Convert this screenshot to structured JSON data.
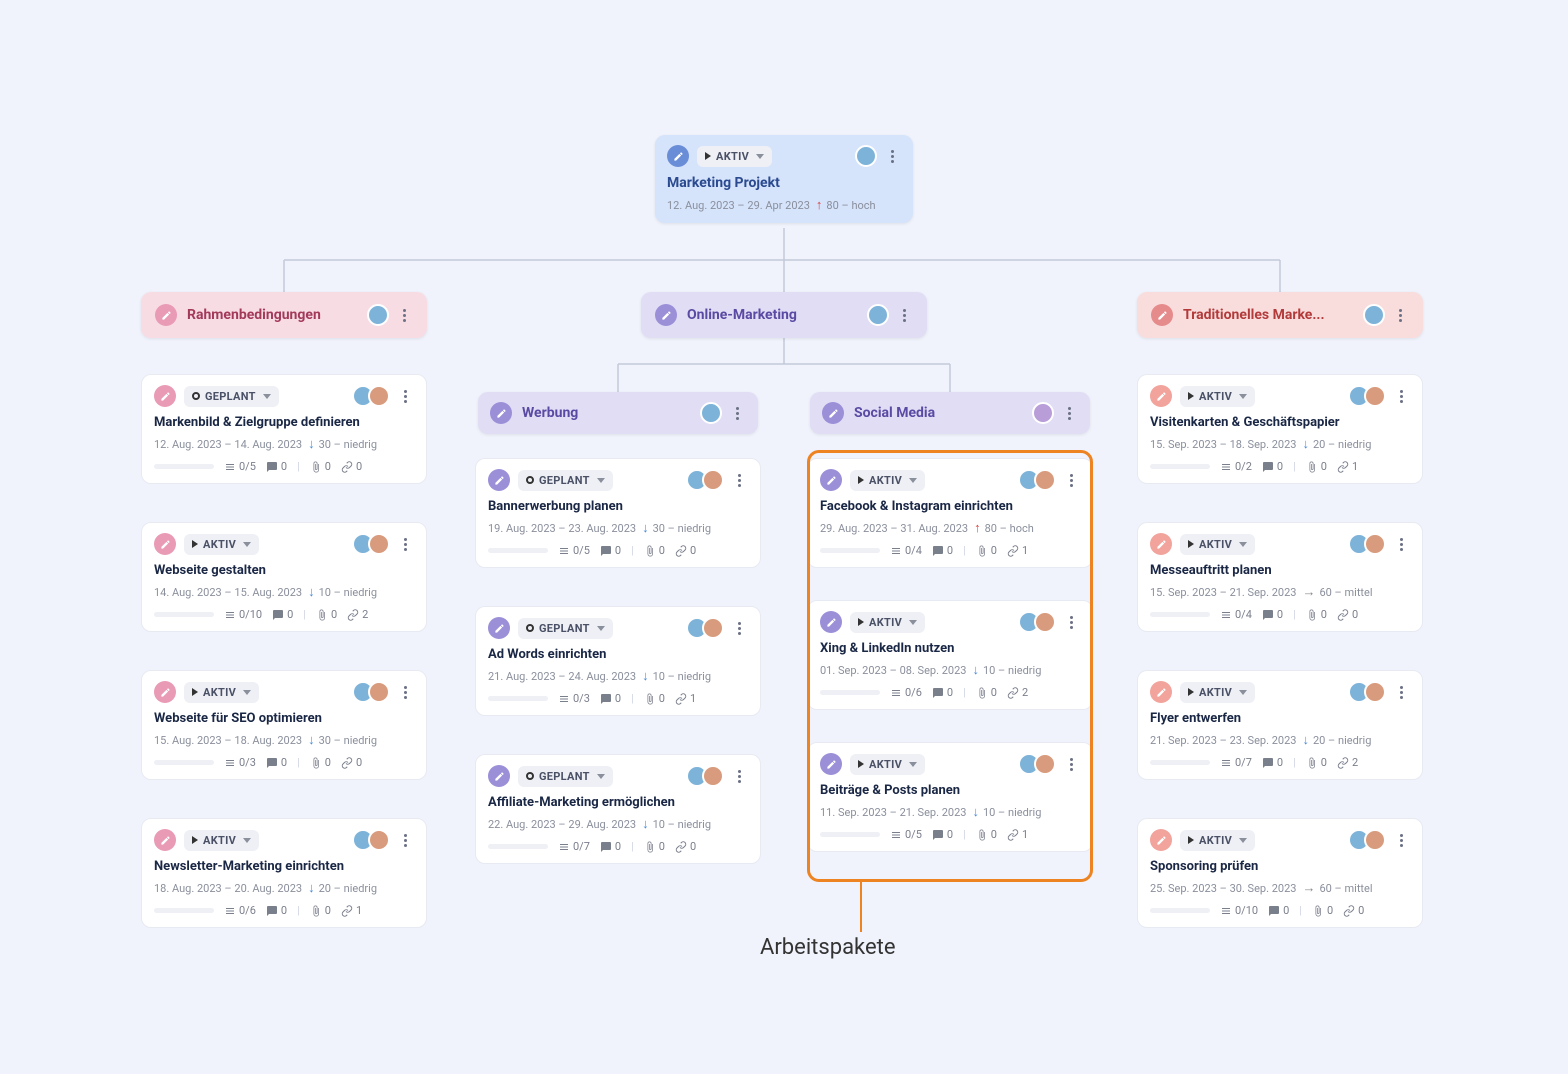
{
  "root": {
    "status": "AKTIV",
    "title": "Marketing Projekt",
    "dates": "12. Aug. 2023 – 29. Apr 2023",
    "prio_arrow": "up",
    "prio": "80 – hoch"
  },
  "categories": [
    {
      "title": "Rahmenbedingungen",
      "color": "pink"
    },
    {
      "title": "Online-Marketing",
      "color": "purple"
    },
    {
      "title": "Traditionelles Marke...",
      "color": "red"
    }
  ],
  "subcategories": [
    {
      "title": "Werbung"
    },
    {
      "title": "Social Media"
    }
  ],
  "cards": {
    "col1": [
      {
        "edit": "pink",
        "statusType": "planned",
        "status": "GEPLANT",
        "title": "Markenbild & Zielgruppe definieren",
        "dates": "12. Aug. 2023 – 14. Aug. 2023",
        "arrow": "down",
        "prio": "30 – niedrig",
        "progress": "0/5",
        "comments": "0",
        "attachments": "0",
        "links": "0"
      },
      {
        "edit": "pink",
        "statusType": "active",
        "status": "AKTIV",
        "title": "Webseite gestalten",
        "dates": "14. Aug. 2023 – 15. Aug. 2023",
        "arrow": "down",
        "prio": "10 – niedrig",
        "progress": "0/10",
        "comments": "0",
        "attachments": "0",
        "links": "2"
      },
      {
        "edit": "pink",
        "statusType": "active",
        "status": "AKTIV",
        "title": "Webseite für SEO optimieren",
        "dates": "15. Aug. 2023 – 18. Aug. 2023",
        "arrow": "down",
        "prio": "30 – niedrig",
        "progress": "0/3",
        "comments": "0",
        "attachments": "0",
        "links": "0"
      },
      {
        "edit": "pink",
        "statusType": "active",
        "status": "AKTIV",
        "title": "Newsletter-Marketing einrichten",
        "dates": "18. Aug. 2023 – 20. Aug. 2023",
        "arrow": "down",
        "prio": "20 – niedrig",
        "progress": "0/6",
        "comments": "0",
        "attachments": "0",
        "links": "1"
      }
    ],
    "col2": [
      {
        "edit": "purple",
        "statusType": "planned",
        "status": "GEPLANT",
        "title": "Bannerwerbung planen",
        "dates": "19. Aug. 2023 – 23. Aug. 2023",
        "arrow": "down",
        "prio": "30 – niedrig",
        "progress": "0/5",
        "comments": "0",
        "attachments": "0",
        "links": "0"
      },
      {
        "edit": "purple",
        "statusType": "planned",
        "status": "GEPLANT",
        "title": "Ad Words einrichten",
        "dates": "21. Aug. 2023 – 24. Aug. 2023",
        "arrow": "down",
        "prio": "10 – niedrig",
        "progress": "0/3",
        "comments": "0",
        "attachments": "0",
        "links": "1"
      },
      {
        "edit": "purple",
        "statusType": "planned",
        "status": "GEPLANT",
        "title": "Affiliate-Marketing ermöglichen",
        "dates": "22. Aug. 2023 – 29. Aug. 2023",
        "arrow": "down",
        "prio": "10 – niedrig",
        "progress": "0/7",
        "comments": "0",
        "attachments": "0",
        "links": "0"
      }
    ],
    "col3": [
      {
        "edit": "purple",
        "statusType": "active",
        "status": "AKTIV",
        "title": "Facebook & Instagram einrichten",
        "dates": "29. Aug. 2023 – 31. Aug. 2023",
        "arrow": "up",
        "prio": "80 – hoch",
        "progress": "0/4",
        "comments": "0",
        "attachments": "0",
        "links": "1"
      },
      {
        "edit": "purple",
        "statusType": "active",
        "status": "AKTIV",
        "title": "Xing & LinkedIn nutzen",
        "dates": "01. Sep. 2023 – 08. Sep. 2023",
        "arrow": "down",
        "prio": "10 – niedrig",
        "progress": "0/6",
        "comments": "0",
        "attachments": "0",
        "links": "2"
      },
      {
        "edit": "purple",
        "statusType": "active",
        "status": "AKTIV",
        "title": "Beiträge & Posts planen",
        "dates": "11. Sep. 2023 – 21. Sep. 2023",
        "arrow": "down",
        "prio": "10 – niedrig",
        "progress": "0/5",
        "comments": "0",
        "attachments": "0",
        "links": "1"
      }
    ],
    "col4": [
      {
        "edit": "salmon",
        "statusType": "active",
        "status": "AKTIV",
        "title": "Visitenkarten & Geschäftspapier",
        "dates": "15. Sep. 2023 – 18. Sep. 2023",
        "arrow": "down",
        "prio": "20 – niedrig",
        "progress": "0/2",
        "comments": "0",
        "attachments": "0",
        "links": "1"
      },
      {
        "edit": "salmon",
        "statusType": "active",
        "status": "AKTIV",
        "title": "Messeauftritt planen",
        "dates": "15. Sep. 2023 – 21. Sep. 2023",
        "arrow": "right",
        "prio": "60 – mittel",
        "progress": "0/4",
        "comments": "0",
        "attachments": "0",
        "links": "0"
      },
      {
        "edit": "salmon",
        "statusType": "active",
        "status": "AKTIV",
        "title": "Flyer entwerfen",
        "dates": "21. Sep. 2023 – 23. Sep. 2023",
        "arrow": "down",
        "prio": "20 – niedrig",
        "progress": "0/7",
        "comments": "0",
        "attachments": "0",
        "links": "2"
      },
      {
        "edit": "salmon",
        "statusType": "active",
        "status": "AKTIV",
        "title": "Sponsoring prüfen",
        "dates": "25. Sep. 2023 – 30. Sep. 2023",
        "arrow": "right",
        "prio": "60 – mittel",
        "progress": "0/10",
        "comments": "0",
        "attachments": "0",
        "links": "0"
      }
    ]
  },
  "annotation": "Arbeitspakete"
}
